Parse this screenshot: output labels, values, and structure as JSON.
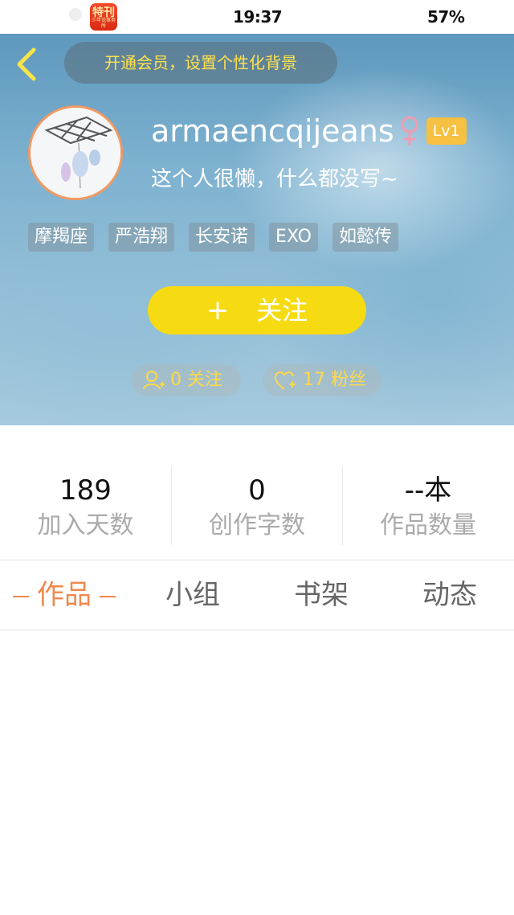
{
  "status_bar": {
    "app_icon_text": "特刊",
    "app_icon_subtext": "少年说事务所",
    "time": "19:37",
    "battery": "57%"
  },
  "header": {
    "vip_banner": "开通会员，设置个性化背景"
  },
  "profile": {
    "username": "armaencqijeans",
    "gender_symbol": "♀",
    "level": "Lv1",
    "bio": "这个人很懒，什么都没写~",
    "tags": [
      "摩羯座",
      "严浩翔",
      "长安诺",
      "EXO",
      "如懿传"
    ],
    "follow_label": "关注",
    "follow_plus": "+",
    "following_text": "0 关注",
    "fans_text": "17 粉丝"
  },
  "stats": [
    {
      "value": "189",
      "label": "加入天数"
    },
    {
      "value": "0",
      "label": "创作字数"
    },
    {
      "value": "--本",
      "label": "作品数量"
    }
  ],
  "tabs": [
    {
      "label": "作品",
      "active": true
    },
    {
      "label": "小组",
      "active": false
    },
    {
      "label": "书架",
      "active": false
    },
    {
      "label": "动态",
      "active": false
    }
  ],
  "colors": {
    "accent_orange": "#f0884d",
    "follow_yellow": "#f6db12",
    "banner_text_yellow": "#ffe14d",
    "level_badge": "#f6c042",
    "gender_pink": "#f29bb0"
  }
}
